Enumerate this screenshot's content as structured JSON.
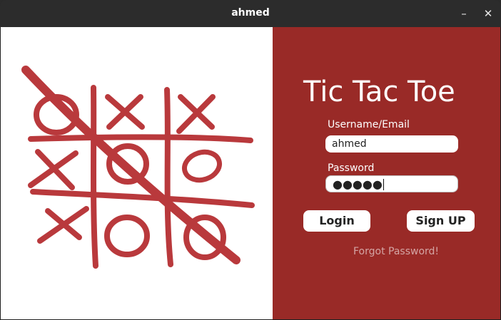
{
  "window": {
    "title": "ahmed",
    "minimize_glyph": "–",
    "close_glyph": "✕"
  },
  "login": {
    "app_title": "Tic Tac Toe",
    "username_label": "Username/Email",
    "username_value": "ahmed",
    "password_label": "Password",
    "password_masked": "●●●●●",
    "login_button": "Login",
    "signup_button": "Sign UP",
    "forgot_link": "Forgot Password!"
  },
  "colors": {
    "panel_red": "#992a27",
    "ink_red": "#b01e22",
    "titlebar": "#2c2c2c"
  },
  "illustration": {
    "icon": "tic-tac-toe-drawing-icon"
  }
}
